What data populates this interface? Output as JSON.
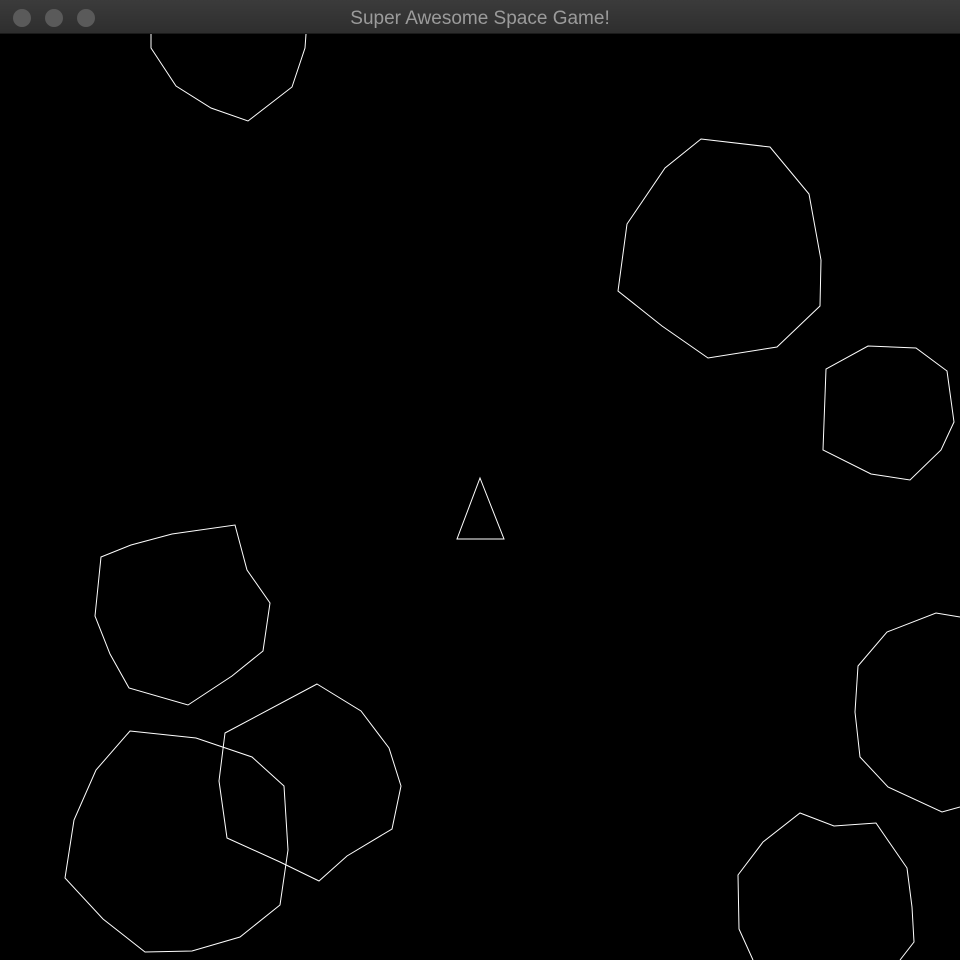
{
  "window": {
    "title": "Super Awesome Space Game!",
    "buttons": [
      {
        "name": "close-button",
        "icon": "close-icon"
      },
      {
        "name": "minimize-button",
        "icon": "minimize-icon"
      },
      {
        "name": "zoom-button",
        "icon": "zoom-icon"
      }
    ]
  },
  "game": {
    "background_color": "#000000",
    "stroke_color": "#ffffff",
    "ship": {
      "shape": "triangle"
    },
    "asteroids": [
      {
        "id": "asteroid-1"
      },
      {
        "id": "asteroid-2"
      },
      {
        "id": "asteroid-3"
      },
      {
        "id": "asteroid-4"
      },
      {
        "id": "asteroid-5"
      },
      {
        "id": "asteroid-6"
      },
      {
        "id": "asteroid-7"
      },
      {
        "id": "asteroid-8"
      }
    ]
  }
}
